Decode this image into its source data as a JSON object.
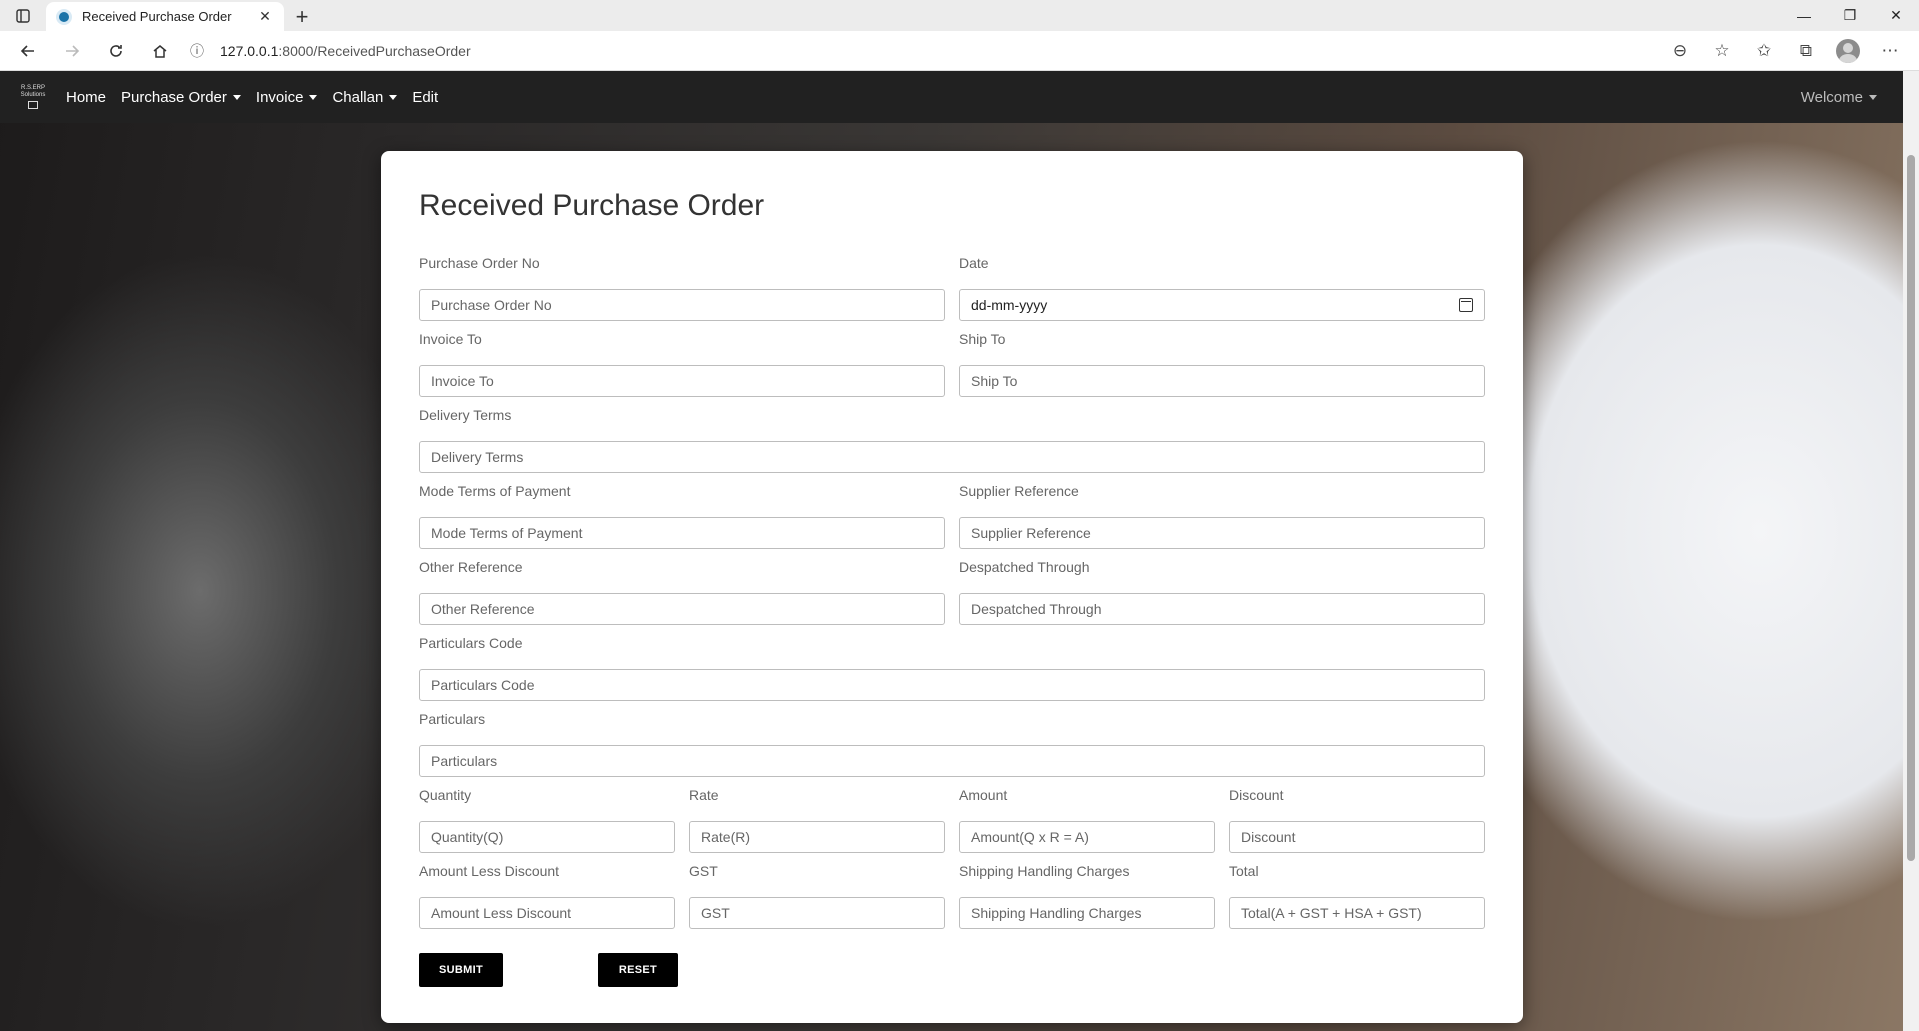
{
  "browser": {
    "tab_title": "Received Purchase Order",
    "url_host": "127.0.0.1",
    "url_path": ":8000/ReceivedPurchaseOrder"
  },
  "navbar": {
    "brand_line1": "R.S.ERP",
    "brand_line2": "Solutions",
    "items": [
      {
        "label": "Home",
        "dropdown": false
      },
      {
        "label": "Purchase Order",
        "dropdown": true
      },
      {
        "label": "Invoice",
        "dropdown": true
      },
      {
        "label": "Challan",
        "dropdown": true
      },
      {
        "label": "Edit",
        "dropdown": false
      }
    ],
    "welcome": "Welcome"
  },
  "form": {
    "title": "Received Purchase Order",
    "purchase_order_no": {
      "label": "Purchase Order No",
      "placeholder": "Purchase Order No"
    },
    "date": {
      "label": "Date",
      "placeholder": "dd-mm-yyyy"
    },
    "invoice_to": {
      "label": "Invoice To",
      "placeholder": "Invoice To"
    },
    "ship_to": {
      "label": "Ship To",
      "placeholder": "Ship To"
    },
    "delivery_terms": {
      "label": "Delivery Terms",
      "placeholder": "Delivery Terms"
    },
    "mode_terms_payment": {
      "label": "Mode Terms of Payment",
      "placeholder": "Mode Terms of Payment"
    },
    "supplier_reference": {
      "label": "Supplier Reference",
      "placeholder": "Supplier Reference"
    },
    "other_reference": {
      "label": "Other Reference",
      "placeholder": "Other Reference"
    },
    "despatched_through": {
      "label": "Despatched Through",
      "placeholder": "Despatched Through"
    },
    "particulars_code": {
      "label": "Particulars Code",
      "placeholder": "Particulars Code"
    },
    "particulars": {
      "label": "Particulars",
      "placeholder": "Particulars"
    },
    "quantity": {
      "label": "Quantity",
      "placeholder": "Quantity(Q)"
    },
    "rate": {
      "label": "Rate",
      "placeholder": "Rate(R)"
    },
    "amount": {
      "label": "Amount",
      "placeholder": "Amount(Q x R = A)"
    },
    "discount": {
      "label": "Discount",
      "placeholder": "Discount"
    },
    "amount_less_discount": {
      "label": "Amount Less Discount",
      "placeholder": "Amount Less Discount"
    },
    "gst": {
      "label": "GST",
      "placeholder": "GST"
    },
    "shipping_handling": {
      "label": "Shipping Handling Charges",
      "placeholder": "Shipping Handling Charges"
    },
    "total": {
      "label": "Total",
      "placeholder": "Total(A + GST + HSA + GST)"
    },
    "submit_label": "SUBMIT",
    "reset_label": "RESET"
  },
  "icons": {
    "back": "back-arrow-icon",
    "forward": "forward-arrow-icon",
    "refresh": "refresh-icon",
    "home": "home-icon",
    "calendar": "calendar-icon"
  }
}
